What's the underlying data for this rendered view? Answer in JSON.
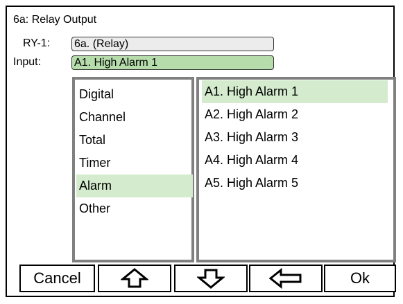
{
  "screen": {
    "title": "6a: Relay Output"
  },
  "device_row": {
    "label": "RY-1:",
    "value": "6a. (Relay)"
  },
  "input_row": {
    "label": "Input:",
    "value": "A1. High Alarm 1"
  },
  "categories": {
    "items": [
      {
        "label": "Digital"
      },
      {
        "label": "Channel"
      },
      {
        "label": "Total"
      },
      {
        "label": "Timer"
      },
      {
        "label": "Alarm"
      },
      {
        "label": "Other"
      }
    ],
    "selected": "Alarm"
  },
  "options": {
    "items": [
      {
        "label": "A1. High Alarm 1"
      },
      {
        "label": "A2. High Alarm 2"
      },
      {
        "label": "A3. High Alarm 3"
      },
      {
        "label": "A4. High Alarm 4"
      },
      {
        "label": "A5. High Alarm 5"
      }
    ],
    "selected": "A1. High Alarm 1"
  },
  "buttons": {
    "cancel_label": "Cancel",
    "up_icon": "arrow-up-outline-icon",
    "down_icon": "arrow-down-outline-icon",
    "back_icon": "arrow-left-outline-icon",
    "ok_label": "Ok"
  },
  "colors": {
    "selection_green": "#b5dcaa",
    "highlight_green": "#d4ebcd",
    "list_border_gray": "#808080",
    "field_gray": "#ececec"
  }
}
